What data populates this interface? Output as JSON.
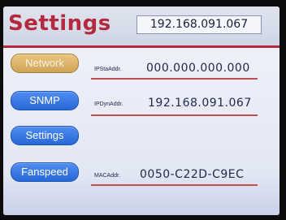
{
  "header": {
    "title": "Settings",
    "ip_display": "192.168.091.067"
  },
  "nav": {
    "items": [
      {
        "label": "Network",
        "active": true
      },
      {
        "label": "SNMP",
        "active": false
      },
      {
        "label": "Settings",
        "active": false
      },
      {
        "label": "Fanspeed",
        "active": false
      }
    ]
  },
  "fields": {
    "ip_sta": {
      "label": "IPStaAddr.",
      "value": "000.000.000.000"
    },
    "ip_dyn": {
      "label": "IPDynAddr.",
      "value": "192.168.091.067"
    },
    "mac": {
      "label": "MACAddr.",
      "value": "0050-C22D-C9EC"
    }
  },
  "colors": {
    "accent": "#b5293f",
    "button_blue": "#2f72df",
    "button_active": "#d8b06a",
    "underline": "#c0504f"
  }
}
